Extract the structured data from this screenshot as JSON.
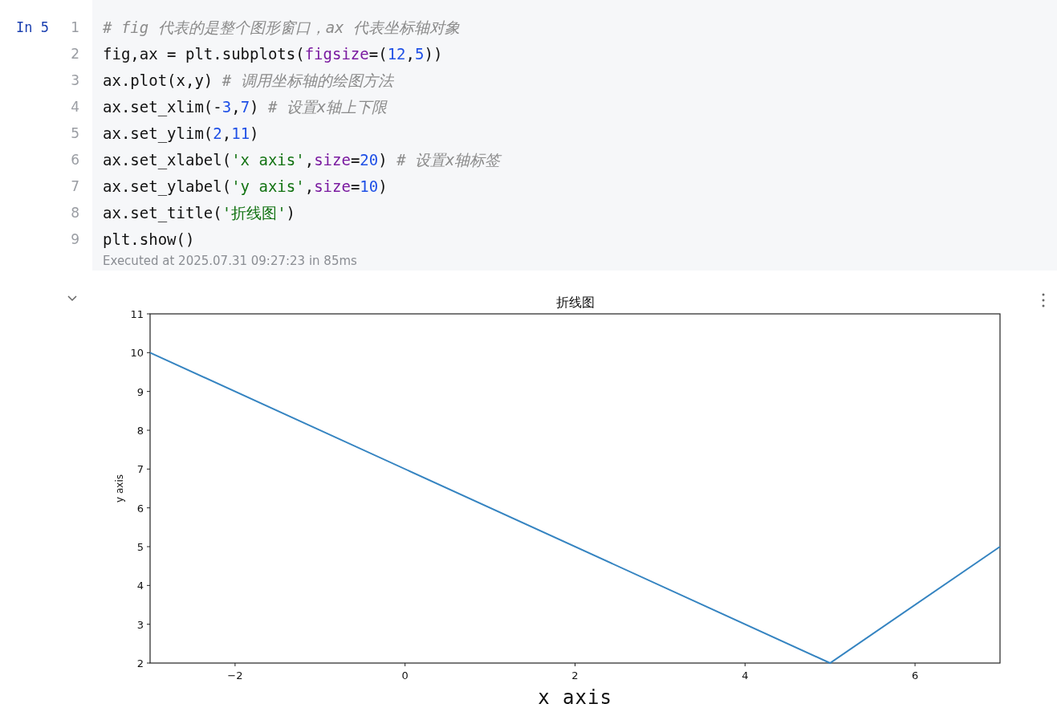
{
  "cell": {
    "prompt": "In 5",
    "lines": [
      {
        "number": "1",
        "tokens": [
          {
            "kind": "comment",
            "text": "# fig 代表的是整个图形窗口，ax 代表坐标轴对象"
          }
        ]
      },
      {
        "number": "2",
        "tokens": [
          {
            "kind": "plain",
            "text": "fig,ax = plt.subplots("
          },
          {
            "kind": "keyword",
            "text": "figsize"
          },
          {
            "kind": "plain",
            "text": "=("
          },
          {
            "kind": "number",
            "text": "12"
          },
          {
            "kind": "plain",
            "text": ","
          },
          {
            "kind": "number",
            "text": "5"
          },
          {
            "kind": "plain",
            "text": "))"
          }
        ]
      },
      {
        "number": "3",
        "tokens": [
          {
            "kind": "plain",
            "text": "ax.plot(x,y) "
          },
          {
            "kind": "comment",
            "text": "# 调用坐标轴的绘图方法"
          }
        ]
      },
      {
        "number": "4",
        "tokens": [
          {
            "kind": "plain",
            "text": "ax.set_xlim(-"
          },
          {
            "kind": "number",
            "text": "3"
          },
          {
            "kind": "plain",
            "text": ","
          },
          {
            "kind": "number",
            "text": "7"
          },
          {
            "kind": "plain",
            "text": ") "
          },
          {
            "kind": "comment",
            "text": "# 设置x轴上下限"
          }
        ]
      },
      {
        "number": "5",
        "tokens": [
          {
            "kind": "plain",
            "text": "ax.set_ylim("
          },
          {
            "kind": "number",
            "text": "2"
          },
          {
            "kind": "plain",
            "text": ","
          },
          {
            "kind": "number",
            "text": "11"
          },
          {
            "kind": "plain",
            "text": ")"
          }
        ]
      },
      {
        "number": "6",
        "tokens": [
          {
            "kind": "plain",
            "text": "ax.set_xlabel("
          },
          {
            "kind": "string",
            "text": "'x axis'"
          },
          {
            "kind": "plain",
            "text": ","
          },
          {
            "kind": "keyword",
            "text": "size"
          },
          {
            "kind": "plain",
            "text": "="
          },
          {
            "kind": "number",
            "text": "20"
          },
          {
            "kind": "plain",
            "text": ") "
          },
          {
            "kind": "comment",
            "text": "# 设置x轴标签"
          }
        ]
      },
      {
        "number": "7",
        "tokens": [
          {
            "kind": "plain",
            "text": "ax.set_ylabel("
          },
          {
            "kind": "string",
            "text": "'y axis'"
          },
          {
            "kind": "plain",
            "text": ","
          },
          {
            "kind": "keyword",
            "text": "size"
          },
          {
            "kind": "plain",
            "text": "="
          },
          {
            "kind": "number",
            "text": "10"
          },
          {
            "kind": "plain",
            "text": ")"
          }
        ]
      },
      {
        "number": "8",
        "tokens": [
          {
            "kind": "plain",
            "text": "ax.set_title("
          },
          {
            "kind": "string",
            "text": "'折线图'"
          },
          {
            "kind": "plain",
            "text": ")"
          }
        ]
      },
      {
        "number": "9",
        "tokens": [
          {
            "kind": "plain",
            "text": "plt.show()"
          }
        ]
      }
    ],
    "execution_info": "Executed at 2025.07.31 09:27:23 in 85ms"
  },
  "output": {
    "chart_data": {
      "type": "line",
      "title": "折线图",
      "xlabel": "x axis",
      "ylabel": "y axis",
      "x": [
        -3,
        5,
        7
      ],
      "series": [
        {
          "color": "#3584c1",
          "values": [
            10,
            2,
            5
          ]
        }
      ],
      "xlim": [
        -3,
        7
      ],
      "ylim": [
        2,
        11
      ],
      "xticks": [
        {
          "value": -2,
          "label": "−2"
        },
        0,
        2,
        4,
        6
      ],
      "yticks": [
        2,
        3,
        4,
        5,
        6,
        7,
        8,
        9,
        10,
        11
      ]
    }
  }
}
